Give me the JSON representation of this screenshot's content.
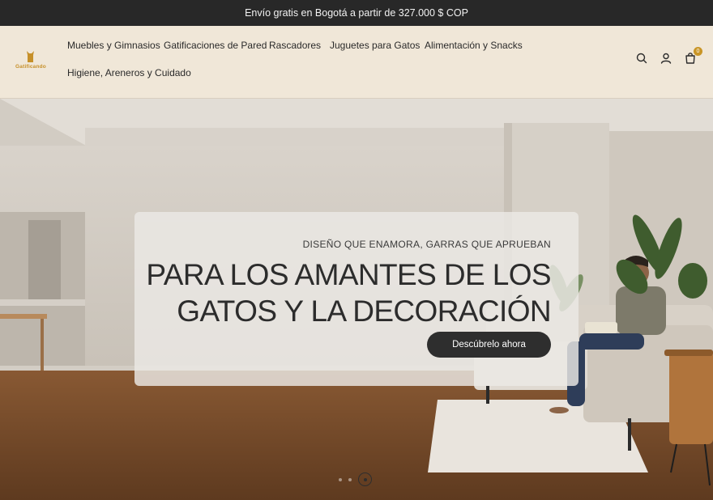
{
  "announcement": "Envío gratis en Bogotá a partir de 327.000 $ COP",
  "brand": {
    "name": "Gatificando",
    "accent": "#c6902a"
  },
  "nav": {
    "items": [
      {
        "label": "Muebles y Gimnasios"
      },
      {
        "label": "Gatificaciones de Pared"
      },
      {
        "label": "Rascadores"
      },
      {
        "label": "Juguetes para Gatos"
      },
      {
        "label": "Alimentación y Snacks"
      },
      {
        "label": "Higiene, Areneros y Cuidado"
      }
    ]
  },
  "header_icons": [
    "search-icon",
    "account-icon",
    "cart-icon"
  ],
  "cart": {
    "count": "0"
  },
  "hero": {
    "kicker": "DISEÑO QUE ENAMORA, GARRAS QUE APRUEBAN",
    "headline": "PARA LOS AMANTES DE LOS GATOS Y LA DECORACIÓN",
    "cta": "Descúbrelo ahora"
  },
  "slideshow": {
    "slides": 3,
    "active": 3
  }
}
